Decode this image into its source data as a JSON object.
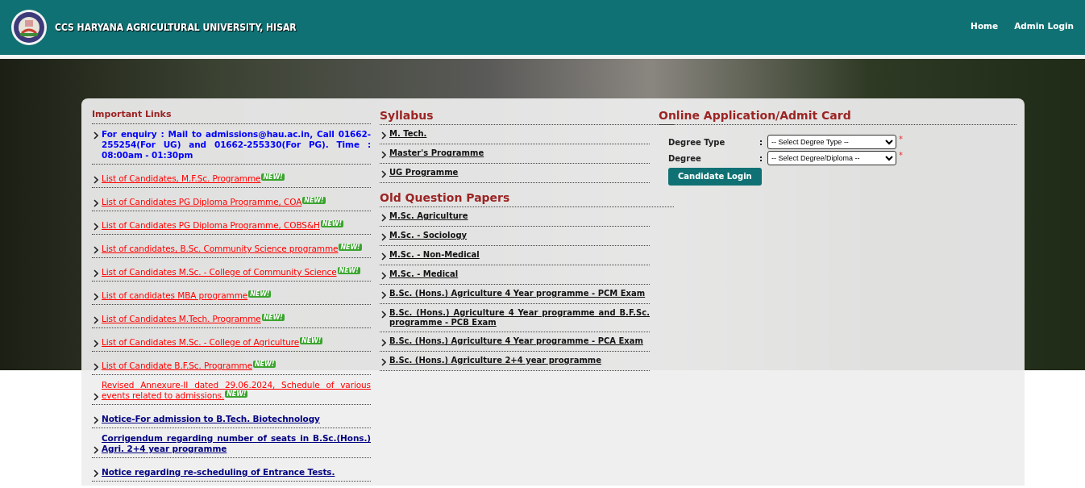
{
  "header": {
    "title": "CCS HARYANA AGRICULTURAL UNIVERSITY, HISAR",
    "nav": [
      "Home",
      "Admin Login"
    ]
  },
  "important_links": {
    "title": "Important Links",
    "items": [
      {
        "kind": "info",
        "text": "For enquiry : Mail to admissions@hau.ac.in, Call 01662-255254(For UG) and 01662-255330(For PG). Time : 08:00am - 01:30pm"
      },
      {
        "kind": "new",
        "text": "List of Candidates, M.F.Sc. Programme",
        "badge": "NEW!"
      },
      {
        "kind": "new",
        "text": "List of Candidates PG Diploma Programme, COA",
        "badge": "NEW!"
      },
      {
        "kind": "new",
        "text": "List of Candidates PG Diploma Programme, COBS&H",
        "badge": "NEW!"
      },
      {
        "kind": "new",
        "text": "List of candidates, B.Sc. Community Science programme",
        "badge": "NEW!"
      },
      {
        "kind": "new",
        "text": "List of Candidates M.Sc. - College of Community Science",
        "badge": "NEW!"
      },
      {
        "kind": "new",
        "text": "List of candidates MBA programme",
        "badge": "NEW!"
      },
      {
        "kind": "new",
        "text": "List of Candidates M.Tech. Programme",
        "badge": "NEW!"
      },
      {
        "kind": "new",
        "text": "List of Candidates M.Sc. - College of Agriculture",
        "badge": "NEW!"
      },
      {
        "kind": "new",
        "text": "List of Candidate B.F.Sc. Programme",
        "badge": "NEW!"
      },
      {
        "kind": "new",
        "text": "Revised Annexure-II dated 29.06.2024, Schedule of various events related to admissions.",
        "badge": "NEW!"
      },
      {
        "kind": "notice",
        "text": "Notice-For admission to B.Tech. Biotechnology"
      },
      {
        "kind": "notice",
        "text": "Corrigendum regarding number of seats in B.Sc.(Hons.) Agri. 2+4 year programme"
      },
      {
        "kind": "notice",
        "text": "Notice regarding re-scheduling of Entrance Tests."
      }
    ]
  },
  "syllabus": {
    "title": "Syllabus",
    "items": [
      "M. Tech.",
      "Master's Programme",
      "UG Programme"
    ]
  },
  "old_question_papers": {
    "title": "Old Question Papers",
    "items": [
      "M.Sc. Agriculture",
      "M.Sc. - Sociology",
      "M.Sc. - Non-Medical",
      "M.Sc. - Medical",
      "B.Sc. (Hons.) Agriculture 4 Year programme - PCM Exam",
      "B.Sc. (Hons.) Agriculture 4 Year programme and B.F.Sc. programme - PCB Exam",
      "B.Sc. (Hons.) Agriculture 4 Year programme - PCA Exam",
      "B.Sc. (Hons.) Agriculture 2+4 year programme"
    ]
  },
  "application": {
    "title": "Online Application/Admit Card",
    "fields": [
      {
        "label": "Degree Type",
        "separator": ":",
        "placeholder": "-- Select Degree Type --",
        "required_mark": "*"
      },
      {
        "label": "Degree",
        "separator": ":",
        "placeholder": "-- Select Degree/Diploma --",
        "required_mark": "*"
      }
    ],
    "button": "Candidate Login"
  }
}
